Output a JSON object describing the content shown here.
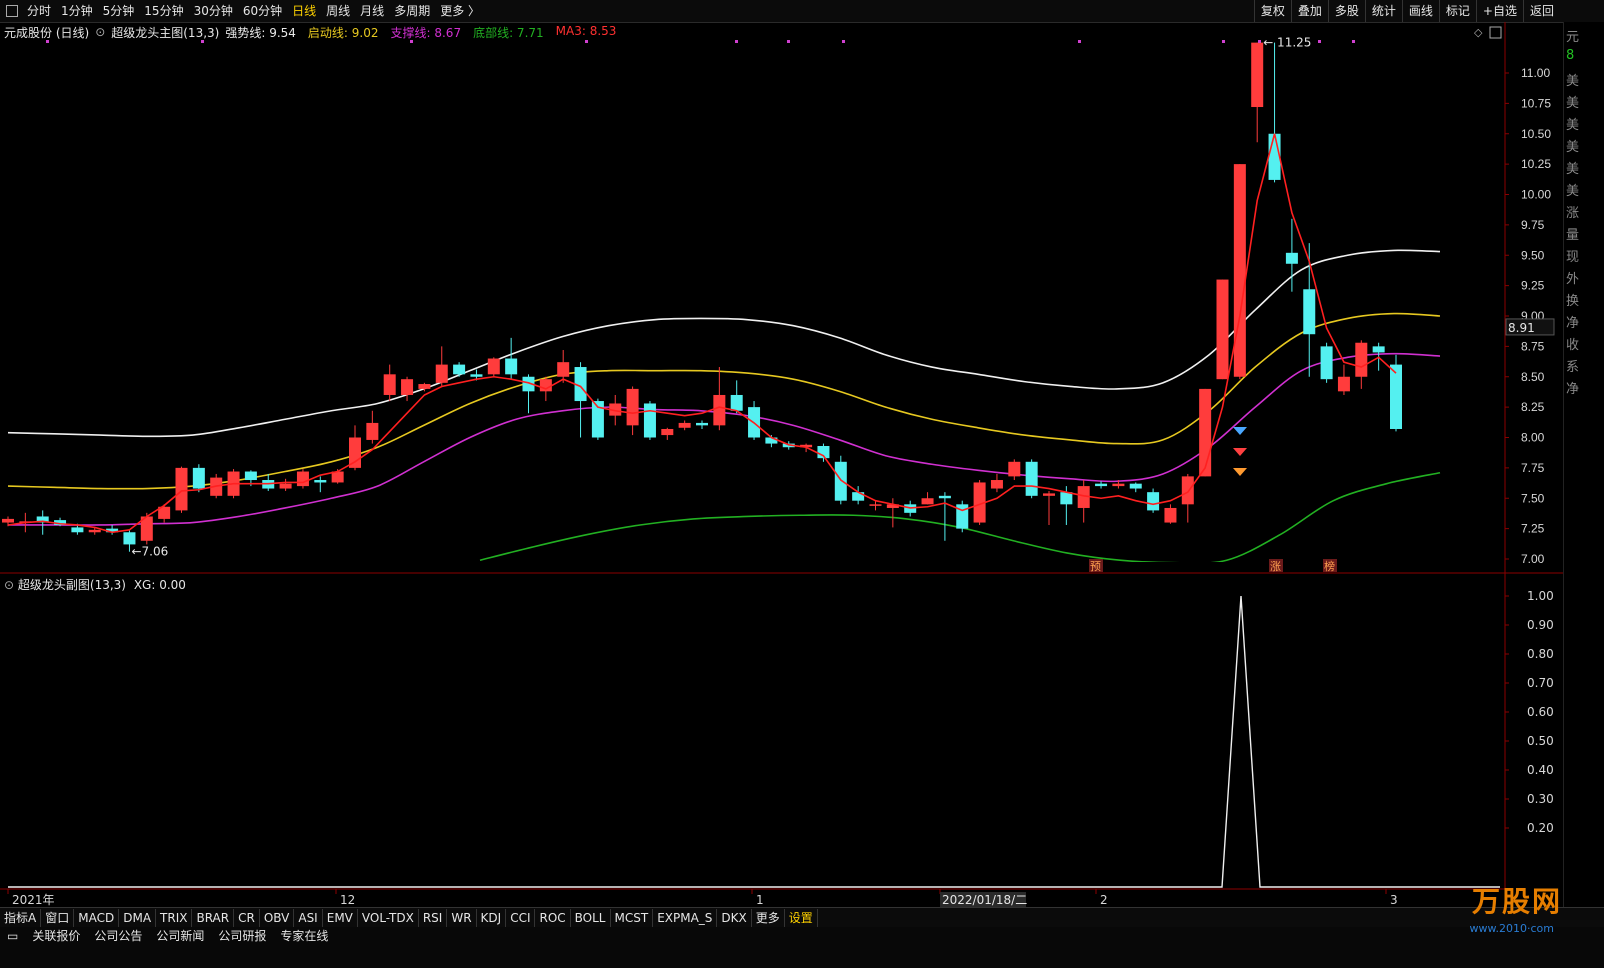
{
  "topbar": {
    "periods": [
      "分时",
      "1分钟",
      "5分钟",
      "15分钟",
      "30分钟",
      "60分钟",
      "日线",
      "周线",
      "月线",
      "多周期",
      "更多 〉"
    ],
    "active_period": "日线",
    "tools": [
      "复权",
      "叠加",
      "多股",
      "统计",
      "画线",
      "标记",
      "+自选",
      "返回"
    ]
  },
  "info": {
    "stock": "元成股份 (日线)",
    "indicator": "超级龙头主图(13,3)",
    "items": [
      {
        "label": "强势线: 9.54",
        "color": "#e8e8e8"
      },
      {
        "label": "启动线: 9.02",
        "color": "#e6c820"
      },
      {
        "label": "支撑线: 8.67",
        "color": "#d030d0"
      },
      {
        "label": "底部线: 7.71",
        "color": "#22b022"
      },
      {
        "label": "MA3: 8.53",
        "color": "#ff3030"
      }
    ]
  },
  "price_axis": [
    "11.00",
    "10.75",
    "10.50",
    "10.25",
    "10.00",
    "9.75",
    "9.50",
    "9.25",
    "9.00",
    "8.75",
    "8.50",
    "8.25",
    "8.00",
    "7.75",
    "7.50",
    "7.25",
    "7.00"
  ],
  "current_price": "8.91",
  "high_label": "11.25",
  "low_label": "7.06",
  "markers": [
    "预",
    "涨",
    "榜"
  ],
  "sub": {
    "title": "超级龙头副图(13,3)",
    "xg": "XG: 0.00",
    "axis": [
      "1.00",
      "0.90",
      "0.80",
      "0.70",
      "0.60",
      "0.50",
      "0.40",
      "0.30",
      "0.20"
    ]
  },
  "dates": [
    "2021年",
    "12",
    "1",
    "2022/01/18/二",
    "2",
    "3"
  ],
  "bottom_tabs": [
    "指标A",
    "窗口",
    "MACD",
    "DMA",
    "TRIX",
    "BRAR",
    "CR",
    "OBV",
    "ASI",
    "EMV",
    "VOL-TDX",
    "RSI",
    "WR",
    "KDJ",
    "CCI",
    "ROC",
    "BOLL",
    "MCST",
    "EXPMA_S",
    "DKX",
    "更多",
    "设置"
  ],
  "footer_links": [
    "关联报价",
    "公司公告",
    "公司新闻",
    "公司研报",
    "专家在线"
  ],
  "watermark": "万股网",
  "watermark_url": "www.2010·com",
  "right_strip_chars": [
    "元",
    "8",
    "美",
    "美",
    "美",
    "美",
    "美",
    "美",
    "涨",
    "量",
    "现",
    "外",
    "换",
    "净",
    "收",
    "系",
    "净"
  ],
  "chart_data": {
    "type": "candlestick",
    "title": "元成股份 (日线)",
    "candles": [
      [
        7.3,
        7.33,
        7.35,
        7.27
      ],
      [
        7.3,
        7.31,
        7.38,
        7.22
      ],
      [
        7.35,
        7.3,
        7.4,
        7.2
      ],
      [
        7.32,
        7.28,
        7.34,
        7.27
      ],
      [
        7.26,
        7.22,
        7.29,
        7.2
      ],
      [
        7.22,
        7.24,
        7.26,
        7.2
      ],
      [
        7.25,
        7.22,
        7.28,
        7.2
      ],
      [
        7.22,
        7.12,
        7.24,
        7.06
      ],
      [
        7.15,
        7.35,
        7.38,
        7.12
      ],
      [
        7.33,
        7.43,
        7.45,
        7.3
      ],
      [
        7.4,
        7.75,
        7.76,
        7.38
      ],
      [
        7.75,
        7.58,
        7.78,
        7.55
      ],
      [
        7.52,
        7.67,
        7.7,
        7.5
      ],
      [
        7.52,
        7.72,
        7.74,
        7.5
      ],
      [
        7.72,
        7.65,
        7.73,
        7.6
      ],
      [
        7.65,
        7.58,
        7.7,
        7.56
      ],
      [
        7.58,
        7.62,
        7.66,
        7.56
      ],
      [
        7.6,
        7.72,
        7.74,
        7.58
      ],
      [
        7.65,
        7.63,
        7.68,
        7.55
      ],
      [
        7.63,
        7.72,
        7.74,
        7.62
      ],
      [
        7.75,
        8.0,
        8.1,
        7.73
      ],
      [
        7.98,
        8.12,
        8.22,
        7.95
      ],
      [
        8.35,
        8.52,
        8.6,
        8.3
      ],
      [
        8.35,
        8.48,
        8.5,
        8.3
      ],
      [
        8.4,
        8.44,
        8.45,
        8.38
      ],
      [
        8.45,
        8.6,
        8.75,
        8.42
      ],
      [
        8.6,
        8.52,
        8.62,
        8.5
      ],
      [
        8.52,
        8.5,
        8.56,
        8.47
      ],
      [
        8.52,
        8.65,
        8.66,
        8.5
      ],
      [
        8.65,
        8.52,
        8.82,
        8.48
      ],
      [
        8.5,
        8.38,
        8.52,
        8.2
      ],
      [
        8.38,
        8.48,
        8.5,
        8.3
      ],
      [
        8.5,
        8.62,
        8.72,
        8.45
      ],
      [
        8.58,
        8.3,
        8.62,
        8.0
      ],
      [
        8.3,
        8.0,
        8.32,
        7.98
      ],
      [
        8.18,
        8.28,
        8.35,
        8.1
      ],
      [
        8.1,
        8.4,
        8.42,
        8.02
      ],
      [
        8.28,
        8.0,
        8.3,
        7.98
      ],
      [
        8.02,
        8.07,
        8.08,
        7.98
      ],
      [
        8.08,
        8.12,
        8.14,
        8.06
      ],
      [
        8.12,
        8.1,
        8.14,
        8.07
      ],
      [
        8.1,
        8.35,
        8.58,
        8.06
      ],
      [
        8.35,
        8.22,
        8.47,
        8.2
      ],
      [
        8.25,
        8.0,
        8.3,
        7.98
      ],
      [
        8.0,
        7.95,
        8.02,
        7.92
      ],
      [
        7.95,
        7.92,
        7.97,
        7.9
      ],
      [
        7.92,
        7.94,
        7.95,
        7.88
      ],
      [
        7.93,
        7.83,
        7.95,
        7.8
      ],
      [
        7.8,
        7.48,
        7.85,
        7.45
      ],
      [
        7.55,
        7.48,
        7.6,
        7.45
      ],
      [
        7.45,
        7.45,
        7.48,
        7.4
      ],
      [
        7.42,
        7.45,
        7.5,
        7.26
      ],
      [
        7.45,
        7.38,
        7.48,
        7.35
      ],
      [
        7.45,
        7.5,
        7.55,
        7.45
      ],
      [
        7.52,
        7.5,
        7.55,
        7.15
      ],
      [
        7.45,
        7.25,
        7.48,
        7.22
      ],
      [
        7.3,
        7.63,
        7.65,
        7.28
      ],
      [
        7.58,
        7.65,
        7.7,
        7.55
      ],
      [
        7.68,
        7.8,
        7.82,
        7.65
      ],
      [
        7.8,
        7.52,
        7.82,
        7.5
      ],
      [
        7.52,
        7.54,
        7.56,
        7.28
      ],
      [
        7.55,
        7.45,
        7.6,
        7.28
      ],
      [
        7.42,
        7.6,
        7.65,
        7.3
      ],
      [
        7.62,
        7.6,
        7.64,
        7.58
      ],
      [
        7.6,
        7.62,
        7.65,
        7.58
      ],
      [
        7.62,
        7.58,
        7.63,
        7.55
      ],
      [
        7.55,
        7.4,
        7.58,
        7.38
      ],
      [
        7.3,
        7.42,
        7.45,
        7.29
      ],
      [
        7.45,
        7.68,
        7.7,
        7.3
      ],
      [
        7.68,
        8.4,
        8.4,
        7.68
      ],
      [
        8.48,
        9.3,
        9.3,
        8.48
      ],
      [
        8.5,
        10.25,
        10.25,
        8.48
      ],
      [
        10.72,
        11.25,
        11.25,
        10.43
      ],
      [
        10.5,
        10.12,
        11.25,
        10.1
      ],
      [
        9.52,
        9.43,
        9.8,
        9.2
      ],
      [
        9.22,
        8.85,
        9.6,
        8.5
      ],
      [
        8.75,
        8.48,
        8.78,
        8.45
      ],
      [
        8.38,
        8.5,
        8.6,
        8.35
      ],
      [
        8.5,
        8.78,
        8.8,
        8.4
      ],
      [
        8.75,
        8.7,
        8.78,
        8.55
      ],
      [
        8.6,
        8.07,
        8.68,
        8.05
      ]
    ],
    "ma3": [
      7.28,
      7.3,
      7.31,
      7.29,
      7.28,
      7.26,
      7.22,
      7.24,
      7.35,
      7.44,
      7.56,
      7.57,
      7.6,
      7.62,
      7.62,
      7.62,
      7.63,
      7.63,
      7.69,
      7.72,
      7.8,
      7.9,
      8.05,
      8.2,
      8.35,
      8.42,
      8.45,
      8.48,
      8.5,
      8.48,
      8.45,
      8.4,
      8.48,
      8.42,
      8.25,
      8.22,
      8.2,
      8.22,
      8.2,
      8.18,
      8.2,
      8.25,
      8.22,
      8.12,
      8.0,
      7.94,
      7.92,
      7.85,
      7.65,
      7.55,
      7.48,
      7.45,
      7.42,
      7.43,
      7.46,
      7.4,
      7.45,
      7.5,
      7.6,
      7.6,
      7.58,
      7.55,
      7.52,
      7.5,
      7.52,
      7.48,
      7.45,
      7.48,
      7.55,
      7.75,
      8.25,
      9.0,
      9.95,
      10.5,
      9.85,
      9.45,
      8.9,
      8.62,
      8.58,
      8.66,
      8.53
    ],
    "lines": [
      {
        "name": "强势线",
        "from": 0,
        "values": [
          8.04,
          8.03,
          8.02,
          8.01,
          8.02,
          8.08,
          8.15,
          8.22,
          8.28,
          8.4,
          8.55,
          8.7,
          8.83,
          8.92,
          8.97,
          8.98,
          8.97,
          8.92,
          8.82,
          8.68,
          8.58,
          8.52,
          8.46,
          8.42,
          8.4,
          8.45,
          8.68,
          9.05,
          9.38,
          9.5,
          9.54,
          9.53
        ]
      },
      {
        "name": "启动线",
        "from": 0,
        "values": [
          7.6,
          7.59,
          7.58,
          7.58,
          7.6,
          7.65,
          7.72,
          7.8,
          7.92,
          8.1,
          8.28,
          8.42,
          8.52,
          8.55,
          8.55,
          8.55,
          8.53,
          8.48,
          8.38,
          8.25,
          8.15,
          8.08,
          8.02,
          7.98,
          7.95,
          7.98,
          8.22,
          8.58,
          8.86,
          8.98,
          9.02,
          9.0
        ]
      },
      {
        "name": "支撑线",
        "from": 0,
        "values": [
          7.28,
          7.28,
          7.28,
          7.29,
          7.3,
          7.35,
          7.42,
          7.5,
          7.6,
          7.8,
          8.0,
          8.15,
          8.22,
          8.25,
          8.23,
          8.22,
          8.18,
          8.1,
          7.98,
          7.85,
          7.78,
          7.73,
          7.69,
          7.66,
          7.64,
          7.7,
          7.92,
          8.25,
          8.55,
          8.66,
          8.69,
          8.67
        ]
      },
      {
        "name": "底部线",
        "from": 13.5,
        "values": [
          6.99,
          7.1,
          7.2,
          7.28,
          7.33,
          7.35,
          7.36,
          7.36,
          7.33,
          7.26,
          7.15,
          7.05,
          6.99,
          6.97,
          6.99,
          7.2,
          7.48,
          7.62,
          7.71
        ]
      }
    ],
    "sub_series": {
      "name": "XG",
      "peak_index": 70,
      "peak_value": 1.0,
      "ylim": [
        0,
        1.0
      ]
    },
    "ylim": [
      6.92,
      11.3
    ]
  }
}
